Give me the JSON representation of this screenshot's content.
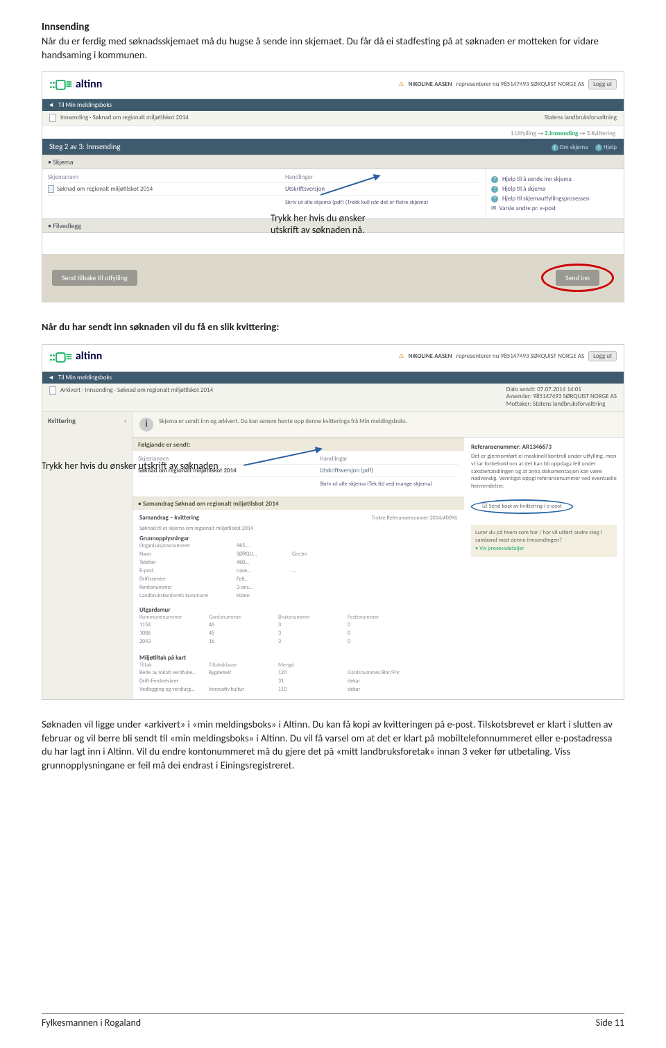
{
  "doc": {
    "h1": "Innsending",
    "p1": "Når du er ferdig med søknadsskjemaet må du hugse å sende inn skjemaet. Du får då ei stadfesting på at søknaden er motteken for vidare handsaming i kommunen.",
    "mid": "Når du har sendt inn søknaden vil du få en slik kvittering:",
    "p2": "Søknaden vil ligge under «arkivert» i «min meldingsboks» i Altinn. Du kan få kopi av kvitteringen på e-post. Tilskotsbrevet er klart i slutten av februar og vil berre bli sendt til «min meldingsboks» i Altinn. Du vil få varsel om at det er klart på mobiltelefonnummeret eller e-postadressa du har lagt inn i Altinn. Vil du endre kontonummeret må du gjere det på «mitt landbruksforetak» innan 3 veker før utbetaling. Viss grunnopplysningane er feil må dei endrast i Einingsregistreret."
  },
  "logo": {
    "glyph": "::▢≡",
    "word": "altinn"
  },
  "user": {
    "icon": "⚠",
    "name": "NIKOLINE AASEN",
    "rep": "representerer nu 985147493 SØRQUIST NORGE AS",
    "logout": "Logg ut"
  },
  "shot1": {
    "navback": "Til Min meldingsboks",
    "crumb_left": "Innsending · Søknad om regionalt miljøtilskot 2014",
    "crumb_right": "Statens landbruksforvaltning",
    "steps": {
      "a": "1.Utfylling",
      "sep": "→",
      "b": "2.Innsending",
      "c": "3.Kvittering"
    },
    "steptitle": "Steg 2 av 3: Innsending",
    "om": "Om skjema",
    "hjelp": "Hjelp",
    "sec_skjema": "• Skjema",
    "th_name": "Skjemanavn",
    "th_act": "Handlinger",
    "row_name": "Søknad om regionalt miljøtilskot 2014",
    "row_act": "Utskriftsversjon",
    "row_note": "Skriv ut alle skjema (pdf) (Trekk kull når det er fleire skjema)",
    "sec_vedlegg": "• Filvedlegg",
    "side": {
      "l1": "Hjelp til å sende inn skjema",
      "l2": "Hjelp til å skjema",
      "l3": "Hjelp til skjemautfyllingsprosessen",
      "l4": "Varsle andre pr. e-post"
    },
    "anno": "Trykk her hvis du ønsker utskrift av søknaden nå.",
    "btn_back": "Send tilbake til utfylling",
    "btn_send": "Send inn"
  },
  "shot2": {
    "navback": "Til Min meldingsboks",
    "crumb_left": "Arkivert · Innsending · Søknad om regionalt miljøtilskot 2014",
    "meta": {
      "dato_l": "Dato sendt:",
      "dato_v": "07.07.2014 14:01",
      "avs_l": "Avsender:",
      "avs_v": "985147493 SØRQUIST NORGE AS",
      "mot_l": "Mottaker:",
      "mot_v": "Statens landbruksforvaltning"
    },
    "kvittering": "Kvittering",
    "info": "Skjema er sendt inn og arkivert. Du kan senere hente opp denne kvitteringa frå Min meldingsboks.",
    "folg": "Følgjande er sendt:",
    "th_name": "Skjemanavn",
    "th_act": "Handlingar",
    "row_name": "Søknad om regionalt miljøtilskot 2014",
    "row_act": "Utskriftsversjon (pdf)",
    "row_note": "Skriv ut alle skjema (Tek tid ved mange skjema)",
    "anno": "Trykk her hvis du ønsker utskrift av søknaden",
    "ref_label": "Referansenummer:",
    "ref_val": "AR1346673",
    "ref_body": "Det er gjennomført ei maskinell kontroll under utfylling, men vi tar forbehold om at det kan bli oppdaga feil under saksbehandlingen og at anna dokumentasjon kan være nødvendig. Vennligst oppgi referansenummer ved eventuelle henvendelser.",
    "send_kopi": "Send kopi av kvittering i e-post",
    "lure": "Lurer du på hvem som har / har vil utført andre steg i samband med denne innsendingen?",
    "vis_pros": "• Vis prosessdetaljer",
    "samm_hdr": "• Samandrag Søknad om regionalt miljøtilskot 2014",
    "samm_title": "Samandrag – kvittering",
    "samm_ref": "Trykte Referansenummer 2014/#0096",
    "samm_sub1": "Søknad til et skjema om regionalt miljøtilskot 2014",
    "grunn": "Grunnopplysningar",
    "gk": {
      "r1": [
        "Organisasjonsnummer",
        "985…",
        ""
      ],
      "r2": [
        "Navn",
        "SØRQU…",
        "Gnr.bn"
      ],
      "r3": [
        "Telefon",
        "480…",
        ""
      ],
      "r4": [
        "E-post",
        "nase…",
        "…"
      ],
      "r5": [
        "Driftssenter",
        "Feit…",
        ""
      ],
      "r6": [
        "Kontonummer",
        "3-ans…",
        ""
      ],
      "r7": [
        "Landbrukskontorets kommune",
        "Hålen",
        ""
      ]
    },
    "utg": "Utgardsmur",
    "ut_hdr": [
      "Kommunenummer",
      "Gardsnummer",
      "Bruksnummer",
      "Festenummer"
    ],
    "ut_rows": [
      [
        "1154",
        "46",
        "3",
        "0"
      ],
      [
        "1086",
        "45",
        "3",
        "0"
      ],
      [
        "2043",
        "16",
        "3",
        "0"
      ]
    ],
    "mil": "Miljøtiltak på kart",
    "mil_hdr": [
      "Tiltak",
      "Tiltaksklasse",
      "Mengd",
      ""
    ],
    "mil_rows": [
      [
        "Beite av lokalt verdfulle…",
        "Bygdebeit",
        "120",
        "Gardsnummer/Bnr/Fnr"
      ],
      [
        "Drift-Ferdselsårer",
        "",
        "31",
        "dekar"
      ],
      [
        "Vedlegging og verdiutg…",
        "Innovativ kultur",
        "110",
        "dekar"
      ]
    ]
  },
  "footer": {
    "left": "Fylkesmannen i Rogaland",
    "right": "Side 11"
  }
}
